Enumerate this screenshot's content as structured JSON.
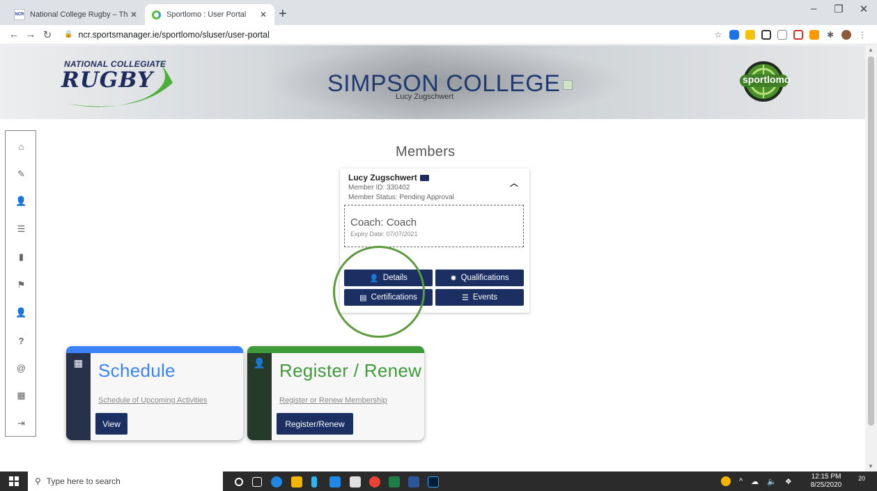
{
  "browser": {
    "tabs": [
      {
        "title": "National College Rugby – The H",
        "favicon": "ncr-favicon"
      },
      {
        "title": "Sportlomo : User Portal",
        "favicon": "sportlomo-favicon"
      }
    ],
    "new_tab": "+",
    "url": "ncr.sportsmanager.ie/sportlomo/sluser/user-portal"
  },
  "banner": {
    "ncr_small": "NATIONAL COLLEGIATE",
    "ncr_big": "RUGBY",
    "college": "SIMPSON COLLEGE",
    "user": "Lucy Zugschwert",
    "sportlomo": "sportlomo"
  },
  "sidebar": {
    "items": [
      "home-icon",
      "edit-icon",
      "user-icon",
      "list-icon",
      "clipboard-icon",
      "flag-icon",
      "user-icon",
      "help-icon",
      "email-icon",
      "building-icon",
      "logout-icon"
    ]
  },
  "members": {
    "title": "Members",
    "name": "Lucy Zugschwert",
    "member_id": "Member ID: 330402",
    "status": "Member Status: Pending Approval",
    "role": "Coach: Coach",
    "expiry": "Expiry Date: 07/07/2021",
    "buttons": {
      "details": "Details",
      "qualifications": "Qualifications",
      "certifications": "Certifications",
      "events": "Events"
    }
  },
  "tiles": {
    "schedule": {
      "title": "Schedule",
      "link": "Schedule of Upcoming Activities",
      "button": "View",
      "color": "#3b82f6"
    },
    "register": {
      "title": "Register / Renew",
      "link": "Register or Renew Membership",
      "button": "Register/Renew",
      "color": "#3f9a3a"
    }
  },
  "taskbar": {
    "search_placeholder": "Type here to search",
    "time": "12:15 PM",
    "date": "8/25/2020",
    "notifications": "20"
  },
  "colors": {
    "navy": "#1c2f63",
    "sidebar_dark": "#2b3245",
    "annotation_green": "#5c9a3c"
  }
}
